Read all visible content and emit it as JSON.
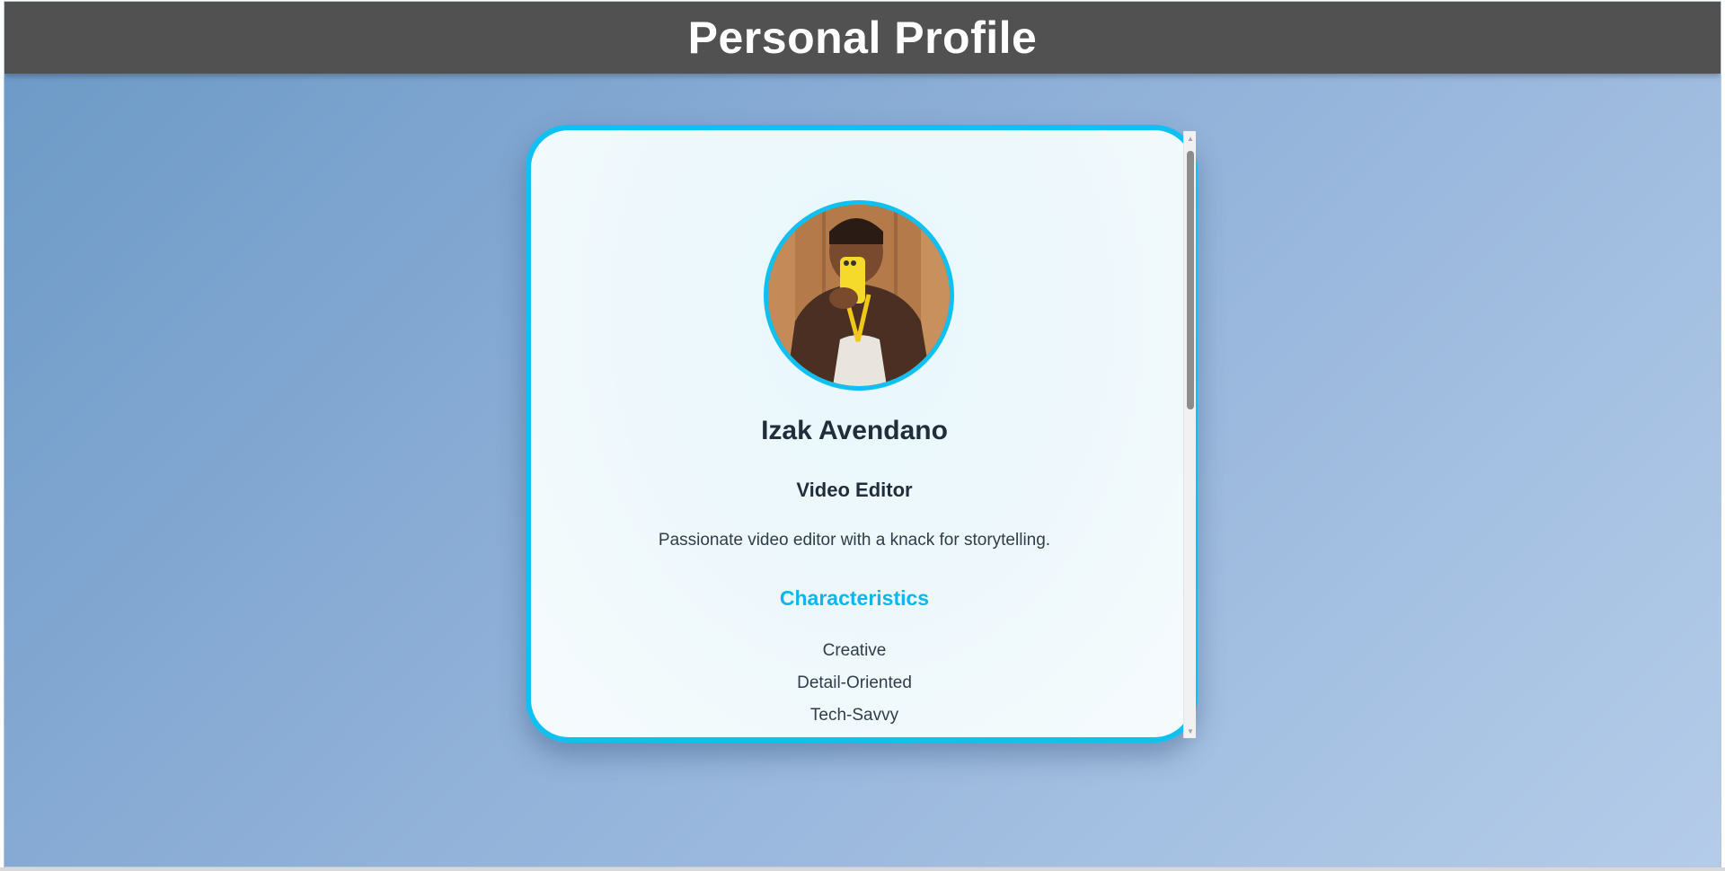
{
  "header": {
    "title": "Personal Profile"
  },
  "profile": {
    "name": "Izak Avendano",
    "role": "Video Editor",
    "bio": "Passionate video editor with a knack for storytelling.",
    "characteristics_title": "Characteristics",
    "characteristics": [
      "Creative",
      "Detail-Oriented",
      "Tech-Savvy"
    ]
  },
  "colors": {
    "header_bg": "#515151",
    "accent": "#0fc0f3",
    "page_gradient_start": "#6b99c6",
    "page_gradient_end": "#b4cce9"
  },
  "icons": {
    "avatar": "profile-photo",
    "scroll_up": "triangle-up-icon",
    "scroll_down": "triangle-down-icon"
  }
}
